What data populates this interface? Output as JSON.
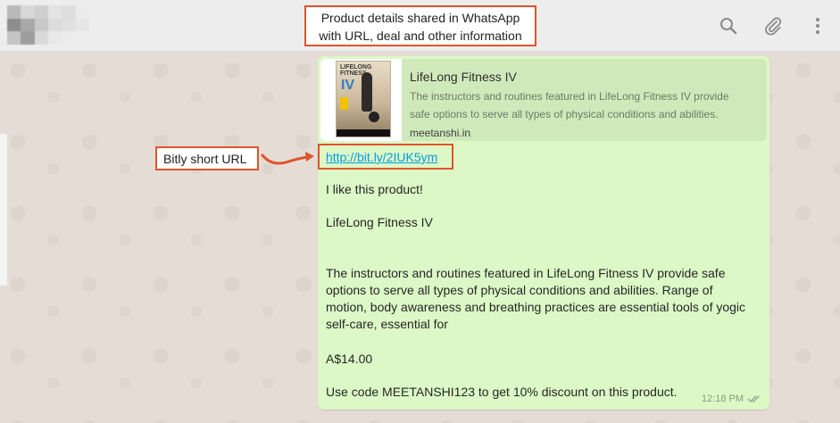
{
  "annotations": {
    "top_callout_line1": "Product details shared in WhatsApp",
    "top_callout_line2": "with URL, deal and other information",
    "left_callout": "Bitly short URL",
    "accent": "#e0532d"
  },
  "header": {
    "icons": [
      "search-icon",
      "paperclip-icon",
      "more-vertical-icon"
    ]
  },
  "message": {
    "preview": {
      "title": "LifeLong Fitness IV",
      "description_line1": "The instructors and routines featured in LifeLong Fitness IV provide",
      "description_line2": "safe options to serve all types of physical conditions and abilities.",
      "domain": "meetanshi.in",
      "thumb_logo_line1": "LIFELONG",
      "thumb_logo_line2": "FITNESS",
      "thumb_numeral": "IV"
    },
    "url": "http://bit.ly/2IUK5ym",
    "line1": "I like this product!",
    "line2": "LifeLong Fitness IV",
    "body_line1": "The instructors and routines featured in LifeLong Fitness IV provide safe",
    "body_line2": "options to serve all types of physical conditions and abilities. Range of",
    "body_line3": "motion, body awareness and breathing practices are essential tools of yogic",
    "body_line4": "self-care, essential for",
    "price": "A$14.00",
    "coupon": "Use code MEETANSHI123 to get 10% discount on this product.",
    "time": "12:18 PM",
    "bubble_color": "#dcf8c6",
    "link_color": "#039be5"
  }
}
